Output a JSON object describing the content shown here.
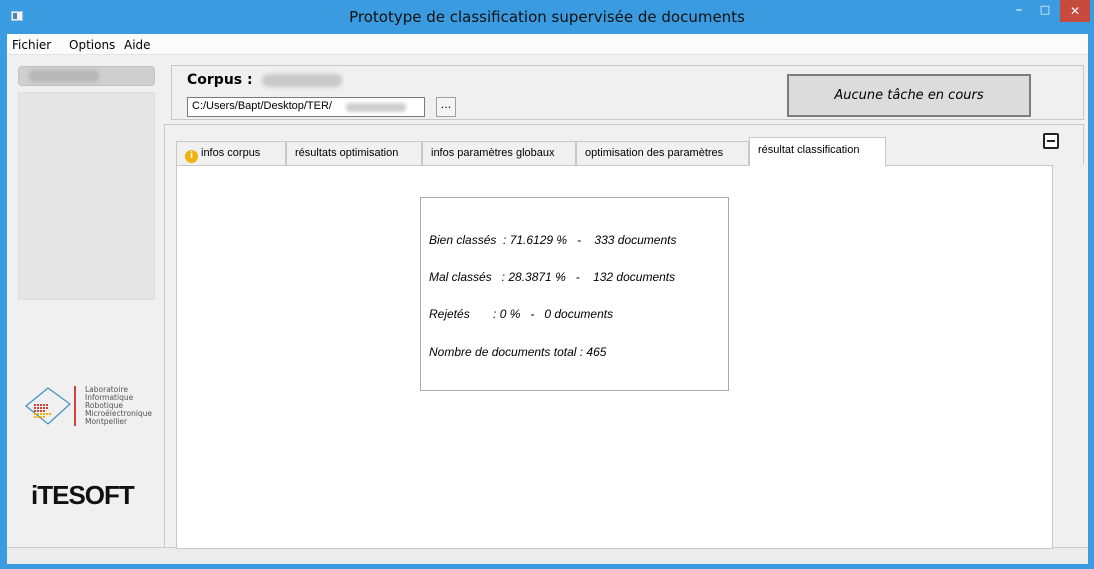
{
  "window": {
    "title": "Prototype de classification supervisée de documents",
    "minimize_glyph": "–",
    "maximize_glyph": "□",
    "close_glyph": "✕"
  },
  "menu": {
    "items": [
      "Fichier",
      "Options",
      "Aide"
    ]
  },
  "corpus": {
    "label": "Corpus :",
    "path_value": "C:/Users/Bapt/Desktop/TER/",
    "browse_label": "...",
    "task_status": "Aucune tâche en cours"
  },
  "tabs": [
    {
      "label": "infos corpus",
      "icon": "info-icon",
      "active": false
    },
    {
      "label": "résultats optimisation",
      "active": false
    },
    {
      "label": "infos paramètres globaux",
      "active": false
    },
    {
      "label": "optimisation des paramètres",
      "active": false
    },
    {
      "label": "résultat classification",
      "active": true
    }
  ],
  "results": {
    "bien_classes": "Bien classés  : 71.6129 %   -    333 documents",
    "mal_classes": "Mal classés   : 28.3871 %   -    132 documents",
    "rejetes": "Rejetés       : 0 %   -   0 documents",
    "total": "Nombre de documents total : 465"
  },
  "logos": {
    "lirmm_lines": [
      "Laboratoire",
      "Informatique",
      "Robotique",
      "Microélectronique",
      "Montpellier"
    ],
    "itesoft": "iTESOFT"
  },
  "colors": {
    "titlebar": "#3b9be0",
    "close_button": "#c74a3f",
    "lirmm_red": "#d0413b",
    "lirmm_blue": "#3f8fc4"
  }
}
